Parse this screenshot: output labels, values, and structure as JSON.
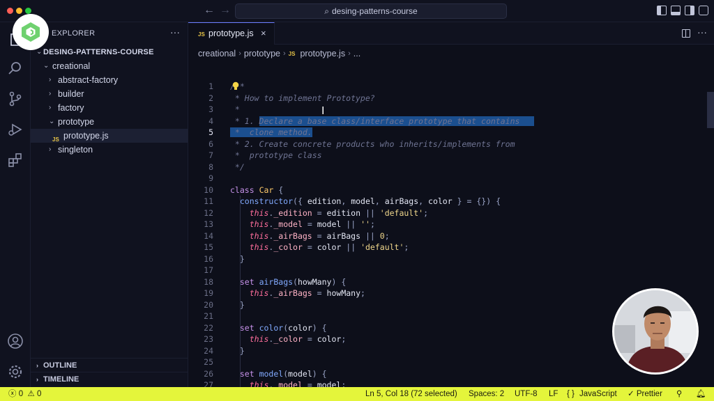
{
  "window": {
    "command_center": "desing-patterns-course"
  },
  "explorer": {
    "title": "EXPLORER",
    "more": "···",
    "root": "DESING-PATTERNS-COURSE",
    "items": [
      {
        "label": "creational",
        "type": "folder",
        "expanded": true
      },
      {
        "label": "abstract-factory",
        "type": "folder",
        "expanded": false
      },
      {
        "label": "builder",
        "type": "folder",
        "expanded": false
      },
      {
        "label": "factory",
        "type": "folder",
        "expanded": false
      },
      {
        "label": "prototype",
        "type": "folder",
        "expanded": true
      },
      {
        "label": "prototype.js",
        "type": "file",
        "badge": "JS"
      },
      {
        "label": "singleton",
        "type": "folder",
        "expanded": false
      }
    ],
    "outline": "OUTLINE",
    "timeline": "TIMELINE"
  },
  "editor": {
    "tab": {
      "badge": "JS",
      "label": "prototype.js",
      "close": "×"
    },
    "breadcrumb": [
      "creational",
      "prototype",
      "prototype.js",
      "..."
    ],
    "lines": [
      "/**",
      " * How to implement Prototype?",
      " *",
      " * 1. Declare a base class/interface prototype that contains",
      " *  clone method.",
      " * 2. Create concrete products who inherits/implements from",
      " *  prototype class",
      " */",
      "",
      "class Car {",
      "  constructor({ edition, model, airBags, color } = {}) {",
      "    this._edition = edition || 'default';",
      "    this._model = model || '';",
      "    this._airBags = airBags || 0;",
      "    this._color = color || 'default';",
      "  }",
      "",
      "  set airBags(howMany) {",
      "    this._airBags = howMany;",
      "  }",
      "",
      "  set color(color) {",
      "    this._color = color;",
      "  }",
      "",
      "  set model(model) {",
      "    this._model = model;",
      "  }"
    ],
    "current_line": 5
  },
  "status": {
    "errors": "0",
    "warnings": "0",
    "position": "Ln 5, Col 18 (72 selected)",
    "spaces": "Spaces: 2",
    "encoding": "UTF-8",
    "eol": "LF",
    "language_braces": "{ }",
    "language": "JavaScript",
    "prettier": "Prettier"
  },
  "colors": {
    "status_bar": "#e4f53b",
    "selection": "#1b4f8f",
    "logo_green": "#6fd16f"
  }
}
